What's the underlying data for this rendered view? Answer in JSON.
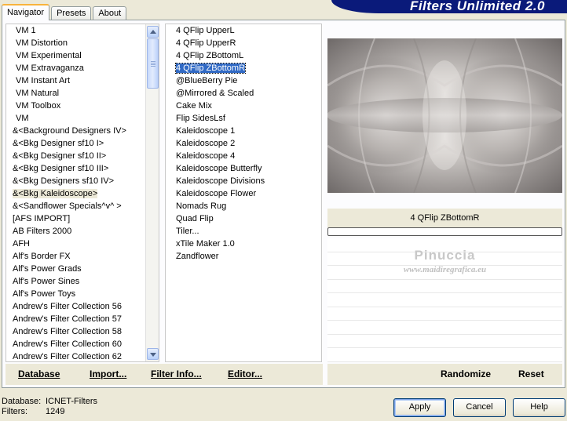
{
  "tabs": [
    "Navigator",
    "Presets",
    "About"
  ],
  "active_tab": "Navigator",
  "banner_title": "Filters Unlimited 2.0",
  "categories": [
    "VM 1",
    "VM Distortion",
    "VM Experimental",
    "VM Extravaganza",
    "VM Instant Art",
    "VM Natural",
    "VM Toolbox",
    "VM",
    "&<Background Designers IV>",
    "&<Bkg Designer sf10 I>",
    "&<Bkg Designer sf10 II>",
    "&<Bkg Designer sf10 III>",
    "&<Bkg Designers sf10 IV>",
    "&<Bkg Kaleidoscope>",
    "&<Sandflower Specials^v^ >",
    "[AFS IMPORT]",
    "AB Filters 2000",
    "AFH",
    "Alf's Border FX",
    "Alf's Power Grads",
    "Alf's Power Sines",
    "Alf's Power Toys",
    "Andrew's Filter Collection 56",
    "Andrew's Filter Collection 57",
    "Andrew's Filter Collection 58",
    "Andrew's Filter Collection 60",
    "Andrew's Filter Collection 62"
  ],
  "selected_category": "&<Bkg Kaleidoscope>",
  "filters": [
    "4 QFlip UpperL",
    "4 QFlip UpperR",
    "4 QFlip ZBottomL",
    "4 QFlip ZBottomR",
    "@BlueBerry Pie",
    "@Mirrored & Scaled",
    "Cake Mix",
    "Flip SidesLsf",
    "Kaleidoscope 1",
    "Kaleidoscope 2",
    "Kaleidoscope 4",
    "Kaleidoscope Butterfly",
    "Kaleidoscope Divisions",
    "Kaleidoscope Flower",
    "Nomads Rug",
    "Quad Flip",
    "Tiler...",
    "xTile Maker 1.0",
    "Zandflower"
  ],
  "selected_filter": "4 QFlip ZBottomR",
  "list_buttons": {
    "database": "Database",
    "import": "Import...",
    "filter_info": "Filter Info...",
    "editor": "Editor..."
  },
  "preview": {
    "filter_name": "4 QFlip ZBottomR",
    "progress": 0,
    "watermark_name": "Pinuccia",
    "watermark_url": "www.maidiregrafica.eu"
  },
  "right_buttons": {
    "randomize": "Randomize",
    "reset": "Reset"
  },
  "status": {
    "database_label": "Database:",
    "database_value": "ICNET-Filters",
    "filters_label": "Filters:",
    "filters_value": "1249"
  },
  "dialog_buttons": {
    "apply": "Apply",
    "cancel": "Cancel",
    "help": "Help"
  }
}
